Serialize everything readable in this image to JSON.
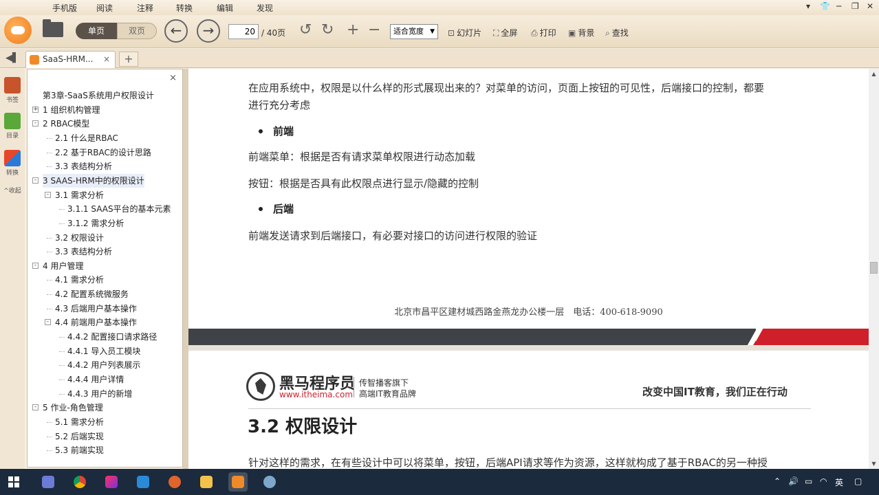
{
  "menubar": {
    "items": [
      "手机版",
      "阅读",
      "注释",
      "转换",
      "编辑",
      "发现"
    ],
    "window_controls": [
      "▾",
      "👕",
      "─",
      "❐",
      "✕"
    ]
  },
  "toolbar": {
    "single_page": "单页",
    "double_page": "双页",
    "current_page": "20",
    "total_pages": "/ 40页",
    "zoom_value": "适合宽度",
    "slideshow": "幻灯片",
    "fullscreen": "全屏",
    "print": "打印",
    "background": "背景",
    "search": "查找"
  },
  "tabs": {
    "active_tab": "SaaS-HRM...",
    "close": "×",
    "add": "+"
  },
  "left_strip": {
    "bookmark": "书签",
    "outline": "目录",
    "convert": "转换",
    "collapse": "收起"
  },
  "outline": {
    "close": "×",
    "items": [
      {
        "label": "第3章-SaaS系统用户权限设计",
        "level": 0,
        "toggle": ""
      },
      {
        "label": "1 组织机构管理",
        "level": 0,
        "toggle": "+"
      },
      {
        "label": "2 RBAC模型",
        "level": 0,
        "toggle": "-"
      },
      {
        "label": "2.1 什么是RBAC",
        "level": 1,
        "toggle": ""
      },
      {
        "label": "2.2 基于RBAC的设计思路",
        "level": 1,
        "toggle": ""
      },
      {
        "label": "3.3 表结构分析",
        "level": 1,
        "toggle": ""
      },
      {
        "label": "3 SAAS-HRM中的权限设计",
        "level": 0,
        "toggle": "-",
        "selected": true
      },
      {
        "label": "3.1 需求分析",
        "level": 1,
        "toggle": "-"
      },
      {
        "label": "3.1.1 SAAS平台的基本元素",
        "level": 2,
        "toggle": ""
      },
      {
        "label": "3.1.2 需求分析",
        "level": 2,
        "toggle": ""
      },
      {
        "label": "3.2 权限设计",
        "level": 1,
        "toggle": ""
      },
      {
        "label": "3.3 表结构分析",
        "level": 1,
        "toggle": ""
      },
      {
        "label": "4 用户管理",
        "level": 0,
        "toggle": "-"
      },
      {
        "label": "4.1 需求分析",
        "level": 1,
        "toggle": ""
      },
      {
        "label": "4.2 配置系统微服务",
        "level": 1,
        "toggle": ""
      },
      {
        "label": "4.3 后端用户基本操作",
        "level": 1,
        "toggle": ""
      },
      {
        "label": "4.4 前端用户基本操作",
        "level": 1,
        "toggle": "-"
      },
      {
        "label": "4.4.2 配置接口请求路径",
        "level": 2,
        "toggle": ""
      },
      {
        "label": "4.4.1 导入员工模块",
        "level": 2,
        "toggle": ""
      },
      {
        "label": "4.4.2 用户列表展示",
        "level": 2,
        "toggle": ""
      },
      {
        "label": "4.4.4 用户详情",
        "level": 2,
        "toggle": ""
      },
      {
        "label": "4.4.3 用户的新增",
        "level": 2,
        "toggle": ""
      },
      {
        "label": "5 作业-角色管理",
        "level": 0,
        "toggle": "-"
      },
      {
        "label": "5.1 需求分析",
        "level": 1,
        "toggle": ""
      },
      {
        "label": "5.2 后端实现",
        "level": 1,
        "toggle": ""
      },
      {
        "label": "5.3 前端实现",
        "level": 1,
        "toggle": ""
      }
    ]
  },
  "document": {
    "intro_line1": "在应用系统中，权限是以什么样的形式展现出来的？对菜单的访问，页面上按钮的可见性，后端接口的控制，都要",
    "intro_line2": "进行充分考虑",
    "bullet_frontend": "前端",
    "frontend_menu": "前端菜单：根据是否有请求菜单权限进行动态加载",
    "frontend_button": "按钮：根据是否具有此权限点进行显示/隐藏的控制",
    "bullet_backend": "后端",
    "backend_text": "前端发送请求到后端接口，有必要对接口的访问进行权限的验证",
    "footer_address": "北京市昌平区建材城西路金燕龙办公楼一层　电话：400-618-9090",
    "brand_name": "黑马程序员",
    "brand_url": "www.itheima.com",
    "brand_sub1": "传智播客旗下",
    "brand_sub2": "高端IT教育品牌",
    "slogan": "改变中国IT教育，我们正在行动",
    "section_title": "3.2 权限设计",
    "section_text": "针对这样的需求，在有些设计中可以将菜单，按钮，后端API请求等作为资源，这样就构成了基于RBAC的另一种授"
  },
  "taskbar": {
    "tray_lang": "英"
  }
}
